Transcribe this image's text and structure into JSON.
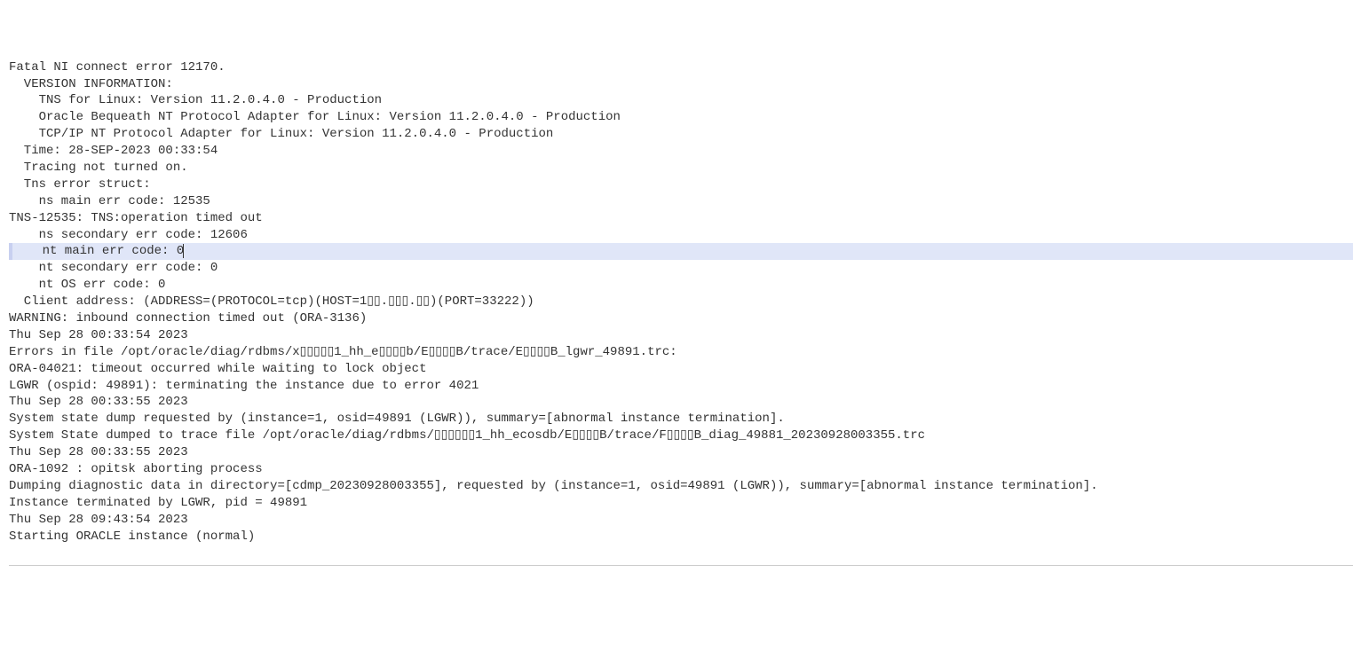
{
  "log": {
    "lines": [
      {
        "text": "Fatal NI connect error 12170."
      },
      {
        "text": ""
      },
      {
        "text": "  VERSION INFORMATION:"
      },
      {
        "text": "    TNS for Linux: Version 11.2.0.4.0 - Production"
      },
      {
        "text": "    Oracle Bequeath NT Protocol Adapter for Linux: Version 11.2.0.4.0 - Production"
      },
      {
        "text": "    TCP/IP NT Protocol Adapter for Linux: Version 11.2.0.4.0 - Production"
      },
      {
        "text": "  Time: 28-SEP-2023 00:33:54"
      },
      {
        "text": "  Tracing not turned on."
      },
      {
        "text": "  Tns error struct:"
      },
      {
        "text": "    ns main err code: 12535"
      },
      {
        "text": ""
      },
      {
        "text": "TNS-12535: TNS:operation timed out"
      },
      {
        "text": "    ns secondary err code: 12606"
      },
      {
        "text": "    nt main err code: 0",
        "highlight": true,
        "cursor": true
      },
      {
        "text": "    nt secondary err code: 0"
      },
      {
        "text": "    nt OS err code: 0"
      },
      {
        "text": "  Client address: (ADDRESS=(PROTOCOL=tcp)(HOST=1▯▯.▯▯▯.▯▯)(PORT=33222))"
      },
      {
        "text": "WARNING: inbound connection timed out (ORA-3136)"
      },
      {
        "text": "Thu Sep 28 00:33:54 2023"
      },
      {
        "text": "Errors in file /opt/oracle/diag/rdbms/x▯▯▯▯▯1_hh_e▯▯▯▯b/E▯▯▯▯B/trace/E▯▯▯▯B_lgwr_49891.trc:"
      },
      {
        "text": "ORA-04021: timeout occurred while waiting to lock object"
      },
      {
        "text": "LGWR (ospid: 49891): terminating the instance due to error 4021"
      },
      {
        "text": "Thu Sep 28 00:33:55 2023"
      },
      {
        "text": "System state dump requested by (instance=1, osid=49891 (LGWR)), summary=[abnormal instance termination]."
      },
      {
        "text": "System State dumped to trace file /opt/oracle/diag/rdbms/▯▯▯▯▯▯1_hh_ecosdb/E▯▯▯▯B/trace/F▯▯▯▯B_diag_49881_20230928003355.trc"
      },
      {
        "text": "Thu Sep 28 00:33:55 2023"
      },
      {
        "text": "ORA-1092 : opitsk aborting process"
      },
      {
        "text": "Dumping diagnostic data in directory=[cdmp_20230928003355], requested by (instance=1, osid=49891 (LGWR)), summary=[abnormal instance termination]."
      },
      {
        "text": "Instance terminated by LGWR, pid = 49891"
      },
      {
        "text": "Thu Sep 28 09:43:54 2023"
      },
      {
        "text": "Starting ORACLE instance (normal)"
      }
    ]
  }
}
